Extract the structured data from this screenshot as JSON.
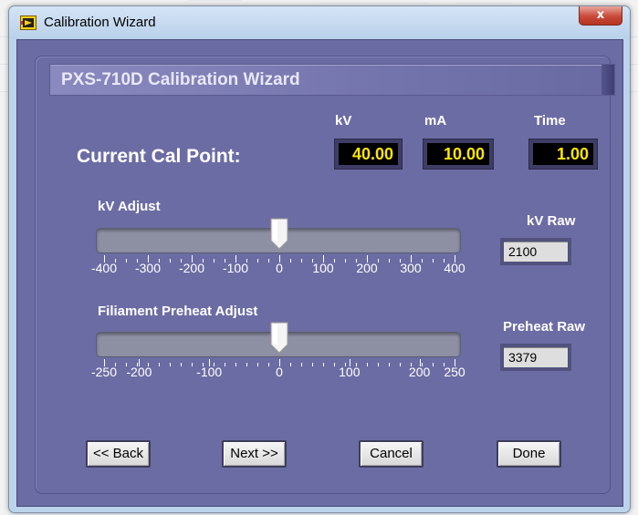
{
  "window": {
    "title": "Calibration Wizard",
    "close_glyph": "x"
  },
  "header": {
    "title": "PXS-710D Calibration Wizard"
  },
  "cal_point": {
    "label": "Current Cal Point:",
    "kv_label": "kV",
    "kv_value": "40.00",
    "ma_label": "mA",
    "ma_value": "10.00",
    "time_label": "Time",
    "time_value": "1.00"
  },
  "kv_slider": {
    "label": "kV Adjust",
    "value": 0,
    "min": -400,
    "max": 400,
    "ticks": [
      "-400",
      "-300",
      "-200",
      "-100",
      "0",
      "100",
      "200",
      "300",
      "400"
    ],
    "raw_label": "kV Raw",
    "raw_value": "2100"
  },
  "preheat_slider": {
    "label": "Filiament Preheat Adjust",
    "value": 0,
    "min": -250,
    "max": 250,
    "ticks": [
      "-250",
      "-200",
      "-100",
      "0",
      "100",
      "200",
      "250"
    ],
    "raw_label": "Preheat Raw",
    "raw_value": "3379"
  },
  "buttons": {
    "back": "<< Back",
    "next": "Next >>",
    "cancel": "Cancel",
    "done": "Done"
  },
  "colors": {
    "panel": "#6c6ca4",
    "display_text": "#ffe600",
    "display_bg": "#000000"
  },
  "icons": {
    "app": "labview-icon",
    "close": "close-icon"
  }
}
